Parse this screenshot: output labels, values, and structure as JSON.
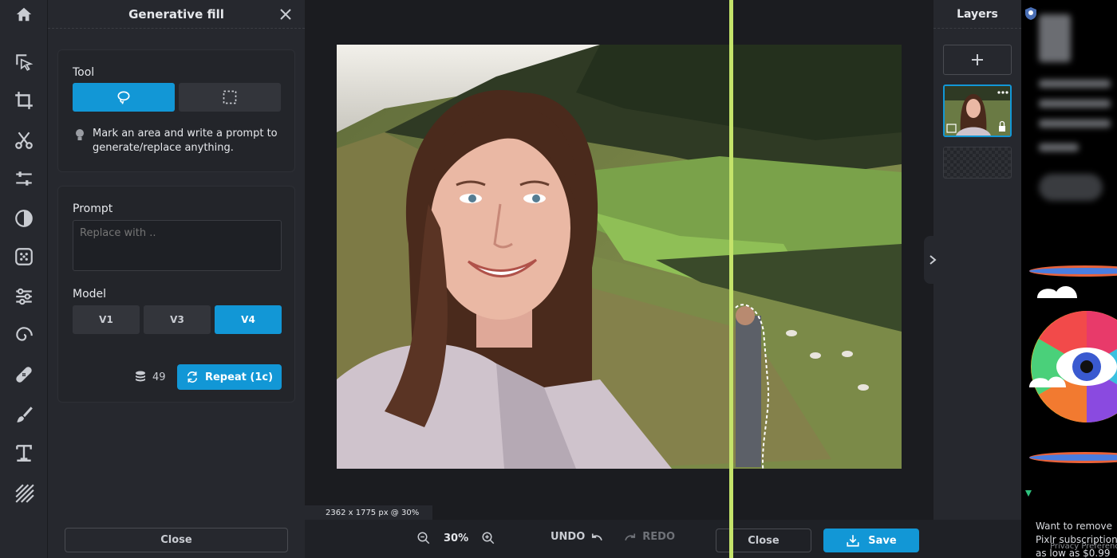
{
  "panel": {
    "title": "Generative fill",
    "tool_label": "Tool",
    "hint": "Mark an area and write a prompt to generate/replace anything.",
    "prompt_label": "Prompt",
    "prompt_placeholder": "Replace with ..",
    "model_label": "Model",
    "models": [
      "V1",
      "V3",
      "V4"
    ],
    "selected_model": "V4",
    "credits": "49",
    "repeat_label": "Repeat (1c)",
    "close_label": "Close"
  },
  "canvas": {
    "image_info": "2362 x 1775 px @ 30%",
    "zoom": "30%",
    "undo_label": "UNDO",
    "redo_label": "REDO",
    "close_label": "Close",
    "save_label": "Save"
  },
  "layers": {
    "title": "Layers"
  },
  "ad": {
    "text": "Want to remove Pixlr subscription as low as $0.99",
    "privacy": "Privacy Preferences"
  },
  "colors": {
    "accent": "#1297d6",
    "split_line": "#c4e36a",
    "panel_bg": "#26282e"
  }
}
